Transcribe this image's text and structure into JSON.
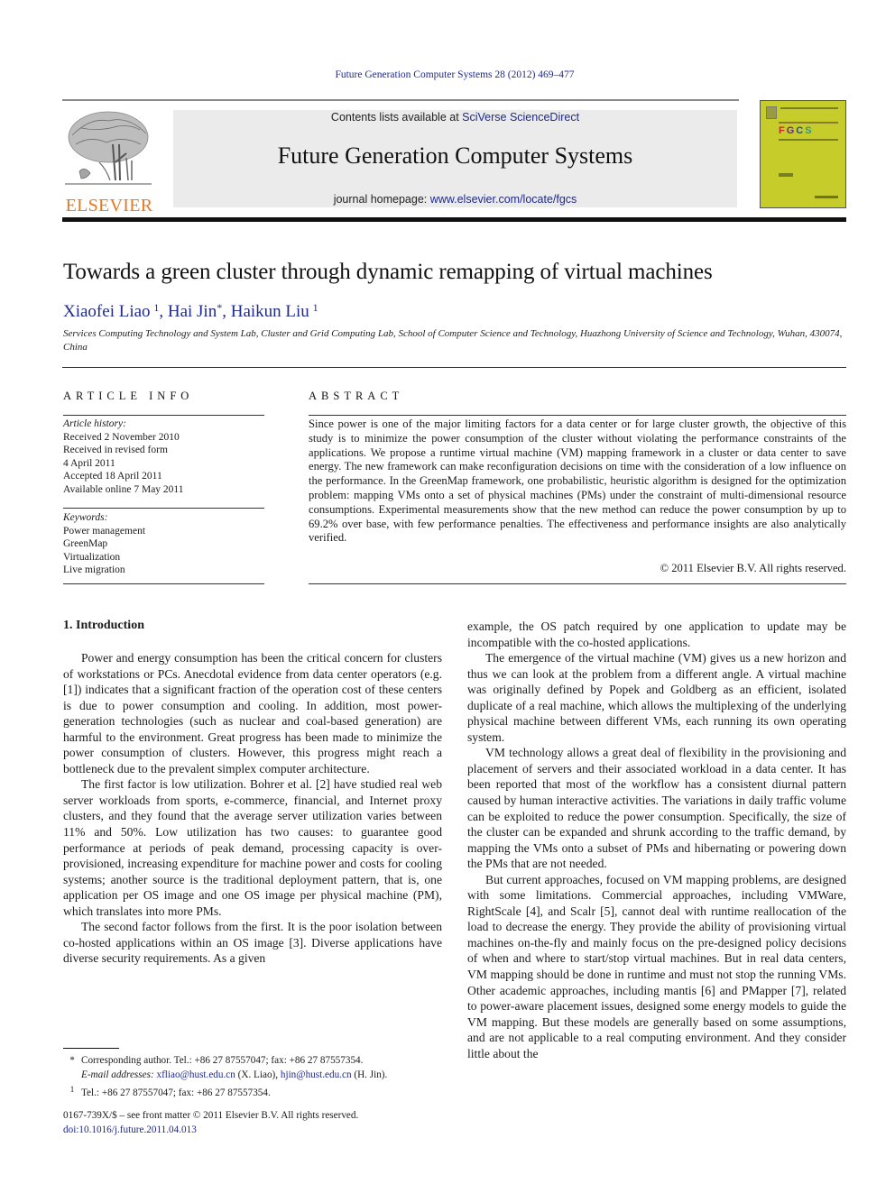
{
  "running_head": "Future Generation Computer Systems 28 (2012) 469–477",
  "publisher": {
    "wordmark": "ELSEVIER",
    "brand_color": "#e8771e"
  },
  "masthead": {
    "contents_prefix": "Contents lists available at ",
    "contents_link": "SciVerse ScienceDirect",
    "journal_title": "Future Generation Computer Systems",
    "homepage_prefix": "journal homepage: ",
    "homepage_link": "www.elsevier.com/locate/fgcs",
    "background": "#ebebeb"
  },
  "cover": {
    "letters": [
      "F",
      "G",
      "C",
      "S"
    ],
    "color": "#c6cc2a"
  },
  "article": {
    "title": "Towards a green cluster through dynamic remapping of virtual machines",
    "authors": [
      {
        "name": "Xiaofei Liao",
        "mark": "1"
      },
      {
        "name": "Hai Jin",
        "mark": "*"
      },
      {
        "name": "Haikun Liu",
        "mark": "1"
      }
    ],
    "affiliation": "Services Computing Technology and System Lab, Cluster and Grid Computing Lab, School of Computer Science and Technology, Huazhong University of Science and Technology, Wuhan, 430074, China"
  },
  "article_info": {
    "heading": "ARTICLE INFO",
    "history_label": "Article history:",
    "history": [
      "Received 2 November 2010",
      "Received in revised form",
      "4 April 2011",
      "Accepted 18 April 2011",
      "Available online 7 May 2011"
    ],
    "keywords_label": "Keywords:",
    "keywords": [
      "Power management",
      "GreenMap",
      "Virtualization",
      "Live migration"
    ]
  },
  "abstract": {
    "heading": "ABSTRACT",
    "text": "Since power is one of the major limiting factors for a data center or for large cluster growth, the objective of this study is to minimize the power consumption of the cluster without violating the performance constraints of the applications. We propose a runtime virtual machine (VM) mapping framework in a cluster or data center to save energy. The new framework can make reconfiguration decisions on time with the consideration of a low influence on the performance. In the GreenMap framework, one probabilistic, heuristic algorithm is designed for the optimization problem: mapping VMs onto a set of physical machines (PMs) under the constraint of multi-dimensional resource consumptions. Experimental measurements show that the new method can reduce the power consumption by up to 69.2% over base, with few performance penalties. The effectiveness and performance insights are also analytically verified.",
    "copyright": "© 2011 Elsevier B.V. All rights reserved."
  },
  "body": {
    "section_heading": "1.  Introduction",
    "left_paragraphs": [
      "Power and energy consumption has been the critical concern for clusters  of workstations or PCs. Anecdotal evidence from data center operators (e.g. [1]) indicates that a significant fraction of the operation cost of these centers is due to power consumption and cooling. In addition, most power-generation technologies (such as nuclear and coal-based generation) are harmful to the environment. Great progress has been made to minimize the power consumption of clusters. However, this progress might reach a bottleneck due to the prevalent simplex computer architecture.",
      "The first factor is low utilization. Bohrer et al. [2] have studied real web server workloads from sports, e-commerce, financial, and Internet proxy clusters, and they found that the average server utilization varies between 11% and 50%. Low utilization has two causes: to guarantee good performance at periods of peak demand, processing capacity is over-provisioned, increasing expenditure for machine power and costs for cooling systems; another source is the traditional deployment pattern, that is, one application per OS image and one OS image per physical machine (PM), which translates into more PMs.",
      "The second factor follows from the first. It is the poor isolation between co-hosted applications within an OS image [3]. Diverse applications have diverse security requirements. As a given"
    ],
    "right_paragraphs": [
      "example, the OS patch required by one application to update may be incompatible with the co-hosted applications.",
      "The emergence of the virtual machine (VM) gives us a new horizon and thus we can look at the problem from a different angle. A virtual machine was originally defined by Popek and Goldberg as an efficient, isolated duplicate of a real machine, which allows the multiplexing of the underlying physical machine between different VMs, each running its own operating system.",
      "VM technology allows a great deal of flexibility in the provisioning and placement of servers and their associated workload in a data center. It has been reported that most of the workflow has a consistent diurnal pattern caused by human interactive activities. The variations in daily traffic volume can be exploited to reduce the power consumption. Specifically, the size of the cluster can be expanded and shrunk according to the traffic demand, by mapping the VMs onto a subset of PMs and hibernating or powering down the PMs that are not needed.",
      "But current approaches, focused on VM mapping problems, are designed with some limitations. Commercial approaches, including VMWare, RightScale [4], and Scalr [5], cannot deal with runtime reallocation of the load to decrease the energy. They provide the ability of provisioning virtual machines on-the-fly and mainly focus on the pre-designed policy decisions of when and where to start/stop virtual machines. But in real data centers, VM mapping should be done in runtime and must not stop the running VMs. Other academic approaches, including mantis [6] and PMapper [7], related to power-aware placement issues, designed some energy models to guide the VM mapping. But these models are generally based on some assumptions, and are not applicable to a real computing environment. And they consider little about the"
    ]
  },
  "footnotes": {
    "corresponding_mark": "*",
    "corresponding": "Corresponding author. Tel.: +86 27 87557047; fax: +86 27 87557354.",
    "email_label": "E-mail addresses:",
    "email_1": "xfliao@hust.edu.cn",
    "email_1_name": " (X. Liao), ",
    "email_2": "hjin@hust.edu.cn",
    "email_2_name": " (H. Jin).",
    "note_1_mark": "1",
    "note_1": "Tel.: +86 27 87557047; fax: +86 27 87557354."
  },
  "front_matter": {
    "issn_line": "0167-739X/$ – see front matter © 2011 Elsevier B.V. All rights reserved.",
    "doi": "doi:10.1016/j.future.2011.04.013"
  }
}
